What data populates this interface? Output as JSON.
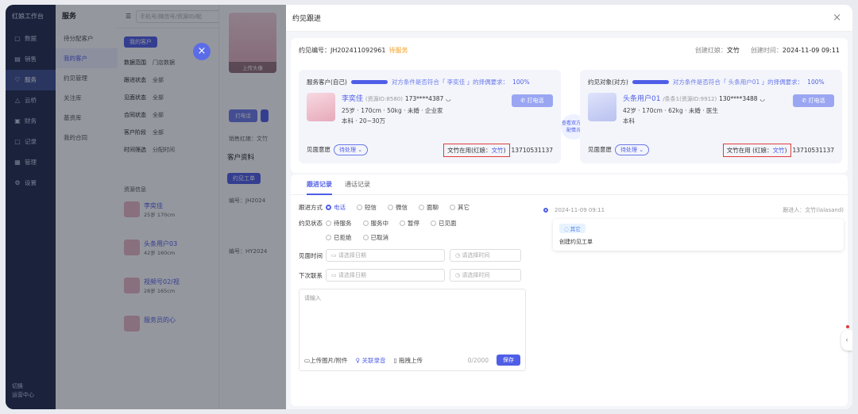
{
  "sidebar": {
    "brand": "红娘工作台",
    "items": [
      {
        "icon": "monitor-icon",
        "glyph": "▢",
        "label": "数据"
      },
      {
        "icon": "chart-icon",
        "glyph": "▤",
        "label": "销售"
      },
      {
        "icon": "heart-icon",
        "glyph": "♡",
        "label": "服务"
      },
      {
        "icon": "mountain-icon",
        "glyph": "△",
        "label": "云桥"
      },
      {
        "icon": "finance-icon",
        "glyph": "▣",
        "label": "财务"
      },
      {
        "icon": "record-icon",
        "glyph": "▢",
        "label": "记录"
      },
      {
        "icon": "manage-icon",
        "glyph": "▦",
        "label": "管理"
      },
      {
        "icon": "settings-icon",
        "glyph": "⚙",
        "label": "设置"
      }
    ],
    "foot_line1": "切换",
    "foot_line2": "运营中心"
  },
  "subnav": {
    "title": "服务",
    "items": [
      "待分配客户",
      "我的客户",
      "约见管理",
      "关注库",
      "基资库",
      "我的合同"
    ]
  },
  "midbg": {
    "search_placeholder": "手机号/微信号/资源ID/昵",
    "tab_label": "我的客户",
    "rows": [
      {
        "k": "数据范围",
        "v": "门店数据"
      },
      {
        "k": "跟进状态",
        "v": "全部"
      },
      {
        "k": "见面状态",
        "v": "全部"
      },
      {
        "k": "合同状态",
        "v": "全部"
      },
      {
        "k": "客户阶段",
        "v": "全部"
      },
      {
        "k": "时间筛选",
        "v": "分配时间"
      }
    ],
    "list_header": "资源信息",
    "persons": [
      {
        "name": "李奕佳",
        "line": "25岁 170cm"
      },
      {
        "name": "头条用户03",
        "line": "42岁 160cm"
      },
      {
        "name": "视频号02/视",
        "line": "28岁 165cm"
      },
      {
        "name": "服务员的心",
        "line": ""
      }
    ]
  },
  "avatar_panel": {
    "upload_label": "上传头像",
    "call_btn": "打电话",
    "sales_label": "销售红娘：文竹",
    "section": "客户资料",
    "tab_order": "约见工单",
    "order_no_prefix": "编号：JH2024",
    "order_no2": "编号：HY2024"
  },
  "drawer": {
    "title": "约见跟进",
    "order_no": "约见编号：JH202411092961",
    "order_status": "待服务",
    "creator_label": "创建红娘：",
    "creator_name": "文竹",
    "created_label": "创建时间：",
    "created_time": "2024-11-09 09:11",
    "left": {
      "role": "服务客户(自己)",
      "match_text": "对方条件是否符合「 李奕佳 」的择偶要求：",
      "match_pct": "100%",
      "name": "李奕佳",
      "resource_id": "(资源ID:8580)",
      "phone": "173****4387",
      "line2": "25岁 · 170cm · 50kg · 未婚 · 企业家",
      "line3": "本科 · 20~30万",
      "call_label": "打电话",
      "meet_label": "见面意愿",
      "pending_label": "待处理",
      "owner_label": "文竹在用(红娘：",
      "owner_name": "文竹",
      "owner_close": ")",
      "owner_phone": "13710531137"
    },
    "right": {
      "role": "约见对象(对方)",
      "match_text": "对方条件是否符合「 头条用户01 」的择偶要求：",
      "match_pct": "100%",
      "name": "头条用户01",
      "resource_id": "/条条1(资源ID:9912)",
      "phone": "130****3488",
      "line2": "42岁 · 170cm · 62kg · 未婚 · 医生",
      "line3": "本科",
      "call_label": "打电话",
      "meet_label": "见面意愿",
      "pending_label": "待处理",
      "owner_label": "文竹在用 (红娘：",
      "owner_name": "文竹",
      "owner_close": ")",
      "owner_phone": "13710531137"
    },
    "mid_link": "查看双方匹配情况",
    "tabs": [
      "跟进记录",
      "通话记录"
    ],
    "form": {
      "method_label": "跟进方式",
      "methods": [
        "电话",
        "短信",
        "微信",
        "面聊",
        "其它"
      ],
      "status_label": "约见状态",
      "statuses_row1": [
        "待服务",
        "服务中",
        "暂停",
        "已见面"
      ],
      "statuses_row2": [
        "已拒绝",
        "已取消"
      ],
      "meet_time_label": "见面时间",
      "next_contact_label": "下次联系",
      "date_placeholder": "请选择日期",
      "time_placeholder": "请选择时间",
      "textarea_placeholder": "请输入",
      "upload_label": "上传图片/附件",
      "record_label": "关联录音",
      "drag_label": "拖拽上传",
      "count": "0/2000",
      "save_label": "保存"
    },
    "timeline": {
      "time": "2024-11-09 09:11",
      "follower": "跟进人：文竹(lalasand)",
      "tag": "其它",
      "text": "创建约见工单"
    }
  }
}
